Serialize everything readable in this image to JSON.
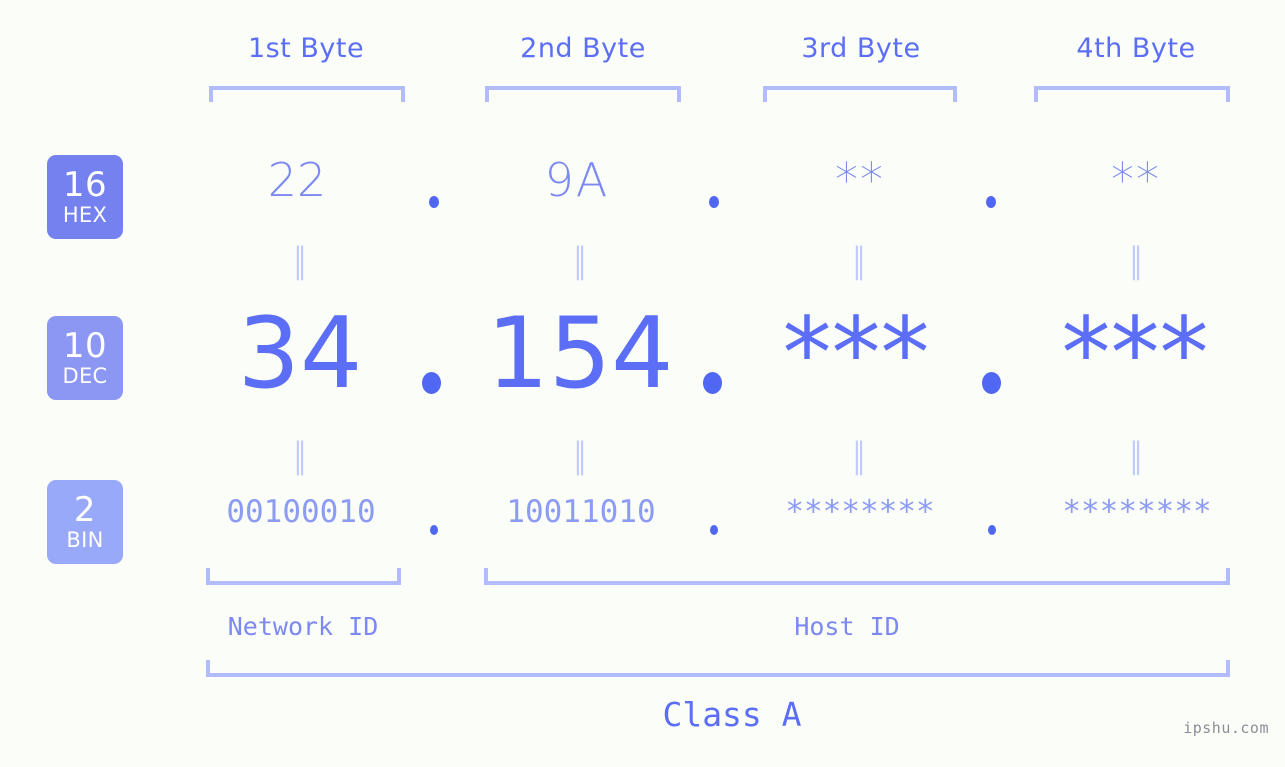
{
  "page": {
    "background_color": "#fbfdf9",
    "accent_color": "#5b6ef5",
    "light_accent_color": "#b3bcfb",
    "watermark": "ipshu.com"
  },
  "byte_headers": [
    {
      "label": "1st Byte"
    },
    {
      "label": "2nd Byte"
    },
    {
      "label": "3rd Byte"
    },
    {
      "label": "4th Byte"
    }
  ],
  "bases": [
    {
      "number": "16",
      "name": "HEX",
      "color": "#7481ef"
    },
    {
      "number": "10",
      "name": "DEC",
      "color": "#8b97f3"
    },
    {
      "number": "2",
      "name": "BIN",
      "color": "#97a9f8"
    }
  ],
  "rows": {
    "hex": {
      "base_number": "16",
      "base_name": "HEX",
      "values": [
        "22",
        "9A",
        "**",
        "**"
      ]
    },
    "dec": {
      "base_number": "10",
      "base_name": "DEC",
      "values": [
        "34",
        "154",
        "***",
        "***"
      ]
    },
    "bin": {
      "base_number": "2",
      "base_name": "BIN",
      "values": [
        "00100010",
        "10011010",
        "********",
        "********"
      ]
    }
  },
  "separators": {
    "dot": "•",
    "equals_bars": "‖"
  },
  "segments": {
    "network_id": "Network ID",
    "host_id": "Host ID",
    "class": "Class A"
  }
}
